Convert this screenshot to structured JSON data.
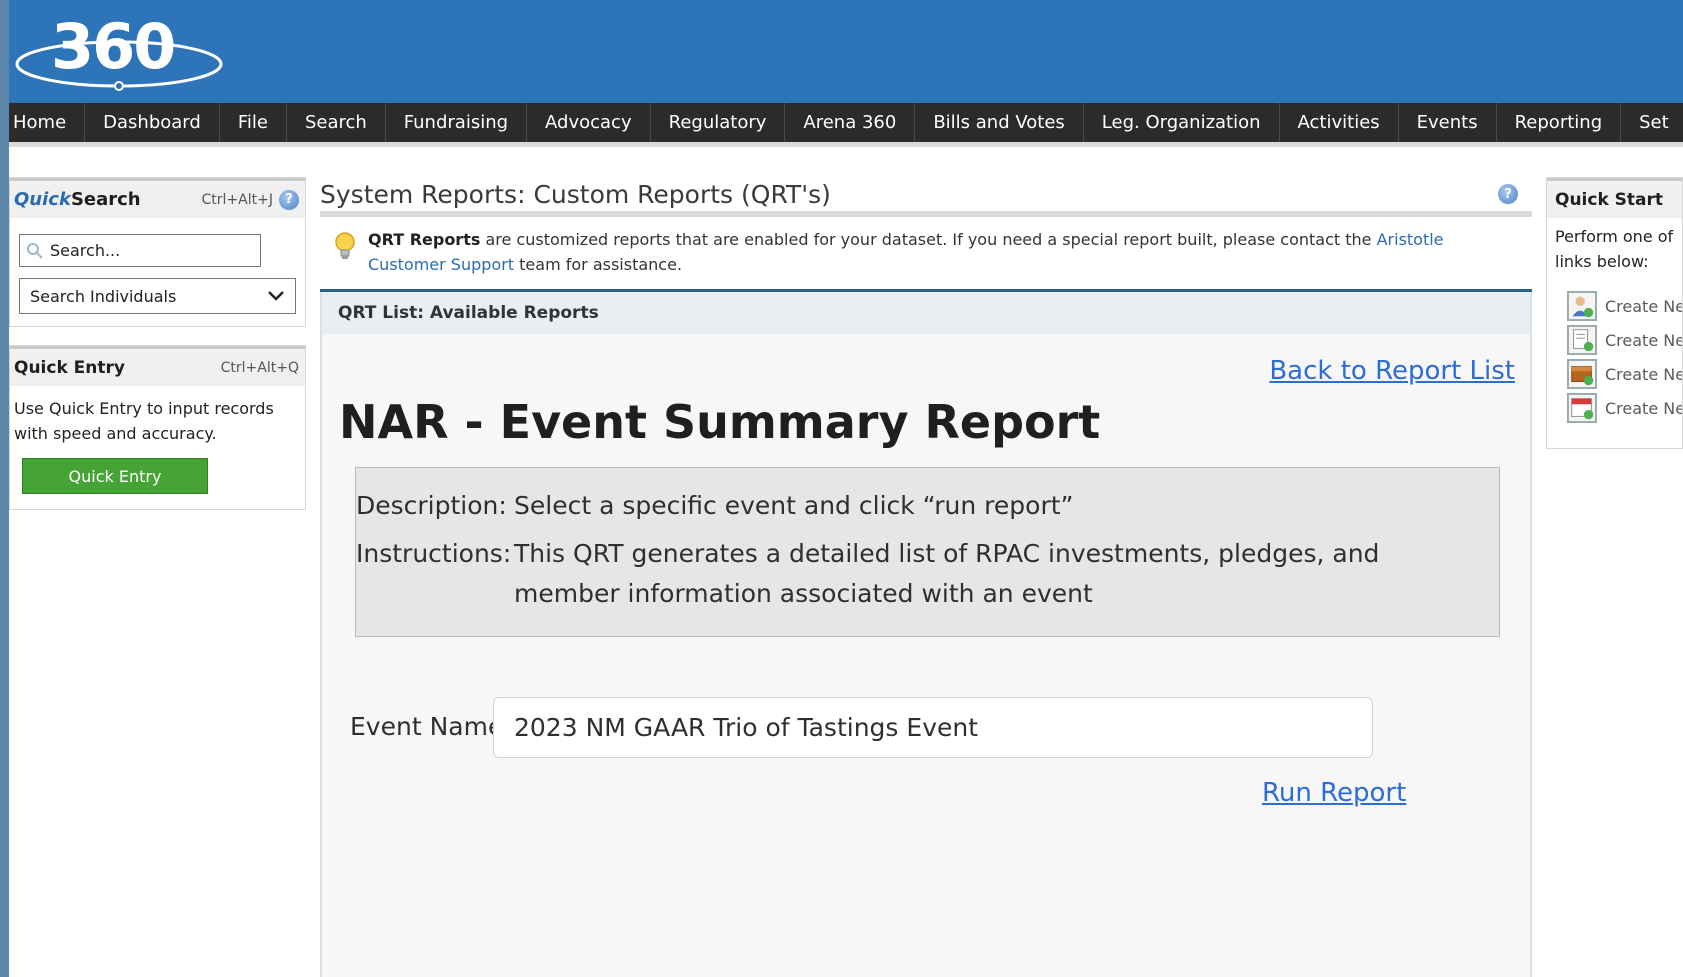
{
  "app": {
    "logo_text": "360"
  },
  "nav": {
    "items": [
      "Home",
      "Dashboard",
      "File",
      "Search",
      "Fundraising",
      "Advocacy",
      "Regulatory",
      "Arena 360",
      "Bills and Votes",
      "Leg. Organization",
      "Activities",
      "Events",
      "Reporting",
      "Set"
    ]
  },
  "quick_search": {
    "title_prefix": "Quick",
    "title_suffix": "Search",
    "shortcut": "Ctrl+Alt+J",
    "search_placeholder": "Search...",
    "type_selected": "Search Individuals"
  },
  "quick_entry": {
    "title": "Quick Entry",
    "shortcut": "Ctrl+Alt+Q",
    "text": "Use Quick Entry to input records with speed and accuracy.",
    "button": "Quick Entry"
  },
  "main": {
    "page_title": "System Reports: Custom Reports (QRT's)",
    "info_bold": "QRT Reports",
    "info_text": " are customized reports that are enabled for your dataset. If you need a special report built, please contact the ",
    "info_link": "Aristotle Customer Support",
    "info_tail": " team for assistance.",
    "section_header": "QRT List: Available Reports",
    "back_link": "Back to Report List",
    "report_title": "NAR - Event Summary Report",
    "description_label": "Description:",
    "description_text": "Select a specific event and click “run report”",
    "instructions_label": "Instructions:",
    "instructions_text": "This QRT generates a detailed list of RPAC investments, pledges, and member information associated with an event",
    "event_label": "Event Name:",
    "event_value": "2023 NM GAAR Trio of Tastings Event",
    "run_link": "Run Report"
  },
  "quick_start": {
    "title": "Quick Start",
    "text_line1": "Perform one of",
    "text_line2": "links below:",
    "items": [
      "Create Ne",
      "Create Ne",
      "Create Ne",
      "Create Ne"
    ]
  },
  "colors": {
    "header_blue": "#2e74b8",
    "nav_dark": "#2b2b2b",
    "button_green": "#46a335",
    "link_blue": "#2b6cd8"
  }
}
